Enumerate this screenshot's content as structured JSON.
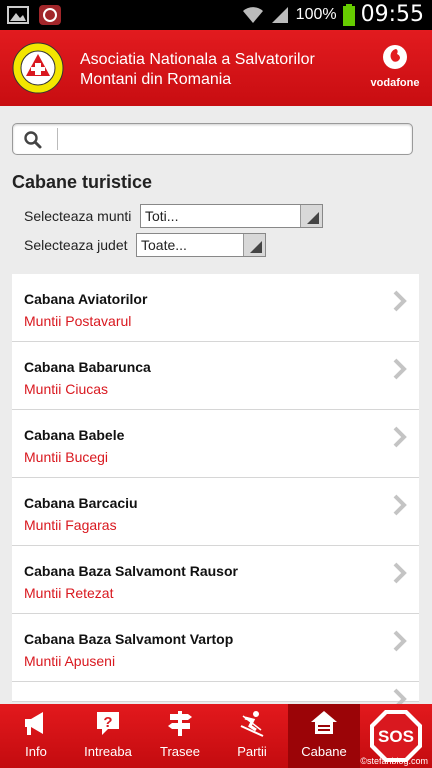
{
  "statusbar": {
    "battery_pct": "100%",
    "time": "09:55"
  },
  "header": {
    "title": "Asociatia Nationala a Salvatorilor Montani din Romania",
    "logo_text": "ROMANIA",
    "brand": "vodafone"
  },
  "search": {
    "value": "",
    "placeholder": ""
  },
  "section_title": "Cabane turistice",
  "filters": {
    "munti_label": "Selecteaza munti",
    "munti_value": "Toti...",
    "judet_label": "Selecteaza judet",
    "judet_value": "Toate..."
  },
  "list": [
    {
      "title": "Cabana Aviatorilor",
      "subtitle": "Muntii Postavarul"
    },
    {
      "title": "Cabana Babarunca",
      "subtitle": "Muntii Ciucas"
    },
    {
      "title": "Cabana Babele",
      "subtitle": "Muntii Bucegi"
    },
    {
      "title": "Cabana Barcaciu",
      "subtitle": "Muntii Fagaras"
    },
    {
      "title": "Cabana Baza Salvamont Rausor",
      "subtitle": "Muntii Retezat"
    },
    {
      "title": "Cabana Baza Salvamont Vartop",
      "subtitle": "Muntii Apuseni"
    }
  ],
  "nav": [
    {
      "label": "Info",
      "icon": "megaphone-icon"
    },
    {
      "label": "Intreaba",
      "icon": "question-icon"
    },
    {
      "label": "Trasee",
      "icon": "signpost-icon"
    },
    {
      "label": "Partii",
      "icon": "skier-icon"
    },
    {
      "label": "Cabane",
      "icon": "cabin-icon"
    }
  ],
  "sos_label": "SOS",
  "watermark": "©stefanblog.com",
  "colors": {
    "accent": "#d9181f",
    "header_red": "#e21b1f",
    "active_tab": "#9b0407"
  }
}
